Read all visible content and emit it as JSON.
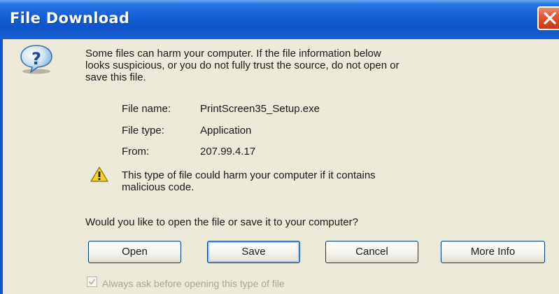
{
  "dialog": {
    "title": "File Download",
    "message_lines": [
      "Some files can harm your computer. If the file information below",
      "looks suspicious, or you do not fully trust the source, do not open or",
      "save this file."
    ],
    "file_info": {
      "name_label": "File name:",
      "name_value": "PrintScreen35_Setup.exe",
      "type_label": "File type:",
      "type_value": "Application",
      "from_label": "From:",
      "from_value": "207.99.4.17"
    },
    "warning_lines": [
      "This type of file could harm your computer if it contains",
      "malicious code."
    ],
    "question": "Would you like to open the file or save it to your computer?",
    "buttons": {
      "open": "Open",
      "save": "Save",
      "cancel": "Cancel",
      "more_info": "More Info"
    },
    "checkbox": {
      "label": "Always ask before opening this type of file",
      "checked": true,
      "enabled": false
    },
    "icons": {
      "question": "question-icon",
      "warning": "warning-icon",
      "close": "close-icon"
    },
    "colors": {
      "titlebar": "#0f54c8",
      "client_bg": "#ece9d8",
      "close_button": "#e0532e"
    }
  }
}
